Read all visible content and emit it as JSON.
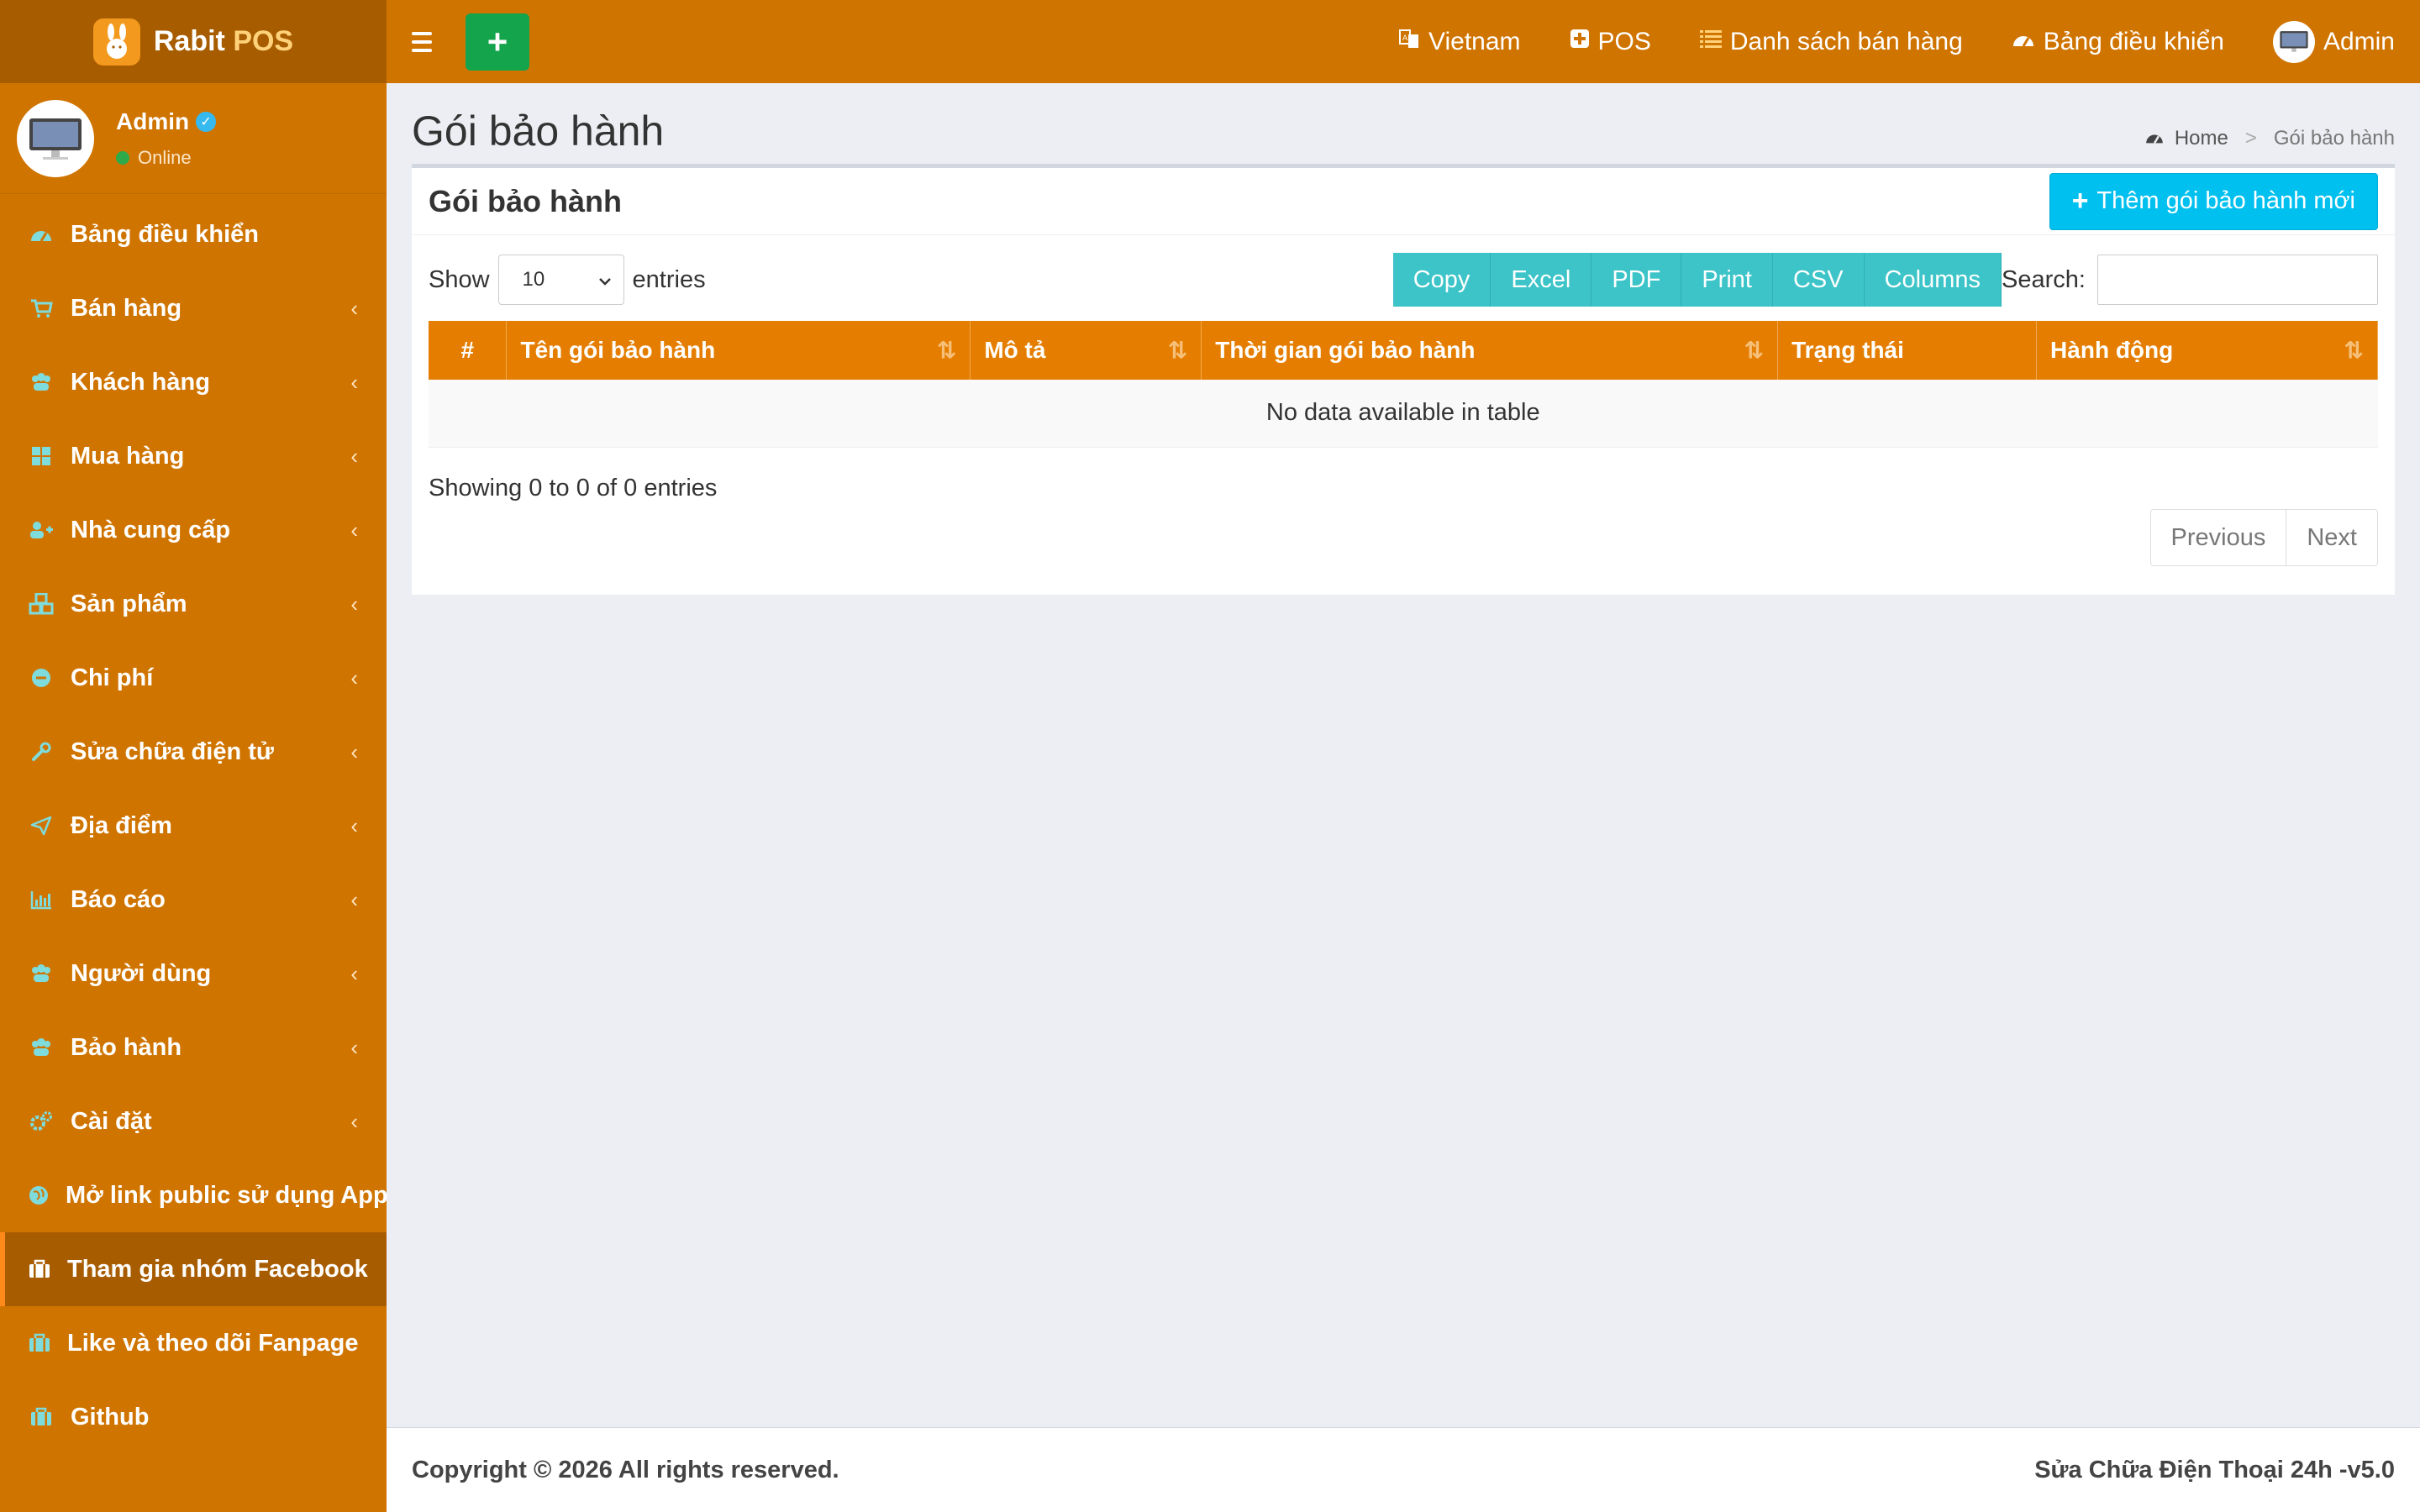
{
  "brand": {
    "name_main": "Rabit",
    "name_accent": "POS"
  },
  "user": {
    "name": "Admin",
    "status": "Online"
  },
  "sidebar": {
    "items": [
      {
        "label": "Bảng điều khiển",
        "icon": "dashboard-icon"
      },
      {
        "label": "Bán hàng",
        "icon": "cart-icon"
      },
      {
        "label": "Khách hàng",
        "icon": "users-icon"
      },
      {
        "label": "Mua hàng",
        "icon": "grid-icon"
      },
      {
        "label": "Nhà cung cấp",
        "icon": "user-plus-icon"
      },
      {
        "label": "Sản phẩm",
        "icon": "cubes-icon"
      },
      {
        "label": "Chi phí",
        "icon": "minus-circle-icon"
      },
      {
        "label": "Sửa chữa điện tử",
        "icon": "wrench-icon"
      },
      {
        "label": "Địa điểm",
        "icon": "paper-plane-icon"
      },
      {
        "label": "Báo cáo",
        "icon": "bar-chart-icon"
      },
      {
        "label": "Người dùng",
        "icon": "users-icon"
      },
      {
        "label": "Bảo hành",
        "icon": "users-icon"
      },
      {
        "label": "Cài đặt",
        "icon": "gears-icon"
      },
      {
        "label": "Mở link public sử dụng App",
        "icon": "globe-icon"
      },
      {
        "label": "Tham gia nhóm Facebook",
        "icon": "briefcase-icon"
      },
      {
        "label": "Like và theo dõi Fanpage",
        "icon": "briefcase-icon"
      },
      {
        "label": "Github",
        "icon": "briefcase-icon"
      }
    ]
  },
  "topbar": {
    "add_label": "+",
    "language": "Vietnam",
    "pos": "POS",
    "sales_list": "Danh sách bán hàng",
    "dashboard": "Bảng điều khiển",
    "user": "Admin"
  },
  "page": {
    "title": "Gói bảo hành",
    "breadcrumb_home": "Home",
    "breadcrumb_sep": ">",
    "breadcrumb_current": "Gói bảo hành"
  },
  "box": {
    "title": "Gói bảo hành",
    "add_button": "Thêm gói bảo hành mới"
  },
  "table_controls": {
    "show_label": "Show",
    "entries_label": "entries",
    "length_value": "10",
    "buttons": [
      "Copy",
      "Excel",
      "PDF",
      "Print",
      "CSV",
      "Columns"
    ],
    "search_label": "Search:"
  },
  "table": {
    "columns": [
      "#",
      "Tên gói bảo hành",
      "Mô tả",
      "Thời gian gói bảo hành",
      "Trạng thái",
      "Hành động"
    ],
    "empty_message": "No data available in table"
  },
  "table_info": "Showing 0 to 0 of 0 entries",
  "pagination": {
    "previous": "Previous",
    "next": "Next"
  },
  "footer": {
    "copyright": "Copyright © 2026 All rights reserved.",
    "version": "Sửa Chữa Điện Thoại 24h -v5.0"
  },
  "colors": {
    "sidebar": "#d07400",
    "sidebar_dark": "#a85c00",
    "table_header": "#e57e00",
    "primary_action": "#00c0ef",
    "dt_buttons": "#3cc4c8",
    "add_green": "#13a44c"
  }
}
